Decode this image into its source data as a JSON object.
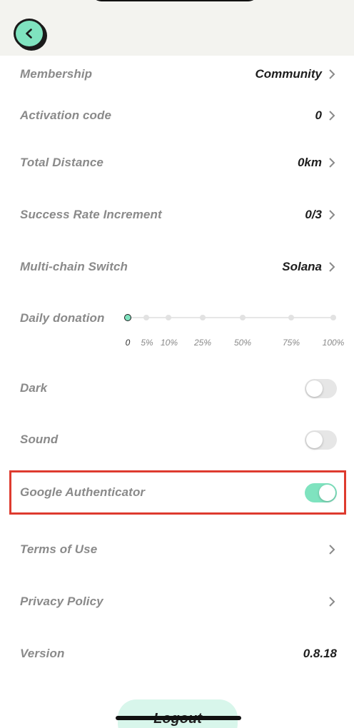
{
  "header": {
    "back_icon": "chevron-left-icon"
  },
  "settings": {
    "membership": {
      "label": "Membership",
      "value": "Community"
    },
    "activation_code": {
      "label": "Activation code",
      "value": "0"
    },
    "total_distance": {
      "label": "Total Distance",
      "value": "0km"
    },
    "success_rate": {
      "label": "Success Rate Increment",
      "value": "0/3"
    },
    "multichain": {
      "label": "Multi-chain Switch",
      "value": "Solana"
    },
    "daily_donation": {
      "label": "Daily donation",
      "ticks": [
        "0",
        "5%",
        "10%",
        "25%",
        "50%",
        "75%",
        "100%"
      ],
      "selected_index": 0
    },
    "dark": {
      "label": "Dark",
      "enabled": false
    },
    "sound": {
      "label": "Sound",
      "enabled": false
    },
    "google_auth": {
      "label": "Google Authenticator",
      "enabled": true
    },
    "terms": {
      "label": "Terms of Use"
    },
    "privacy": {
      "label": "Privacy Policy"
    },
    "version": {
      "label": "Version",
      "value": "0.8.18"
    }
  },
  "logout": {
    "label": "Logout"
  },
  "colors": {
    "accent": "#7fe3bf",
    "highlight": "#de3b2f",
    "label": "#8a8a8a",
    "value": "#1e1e1e"
  }
}
